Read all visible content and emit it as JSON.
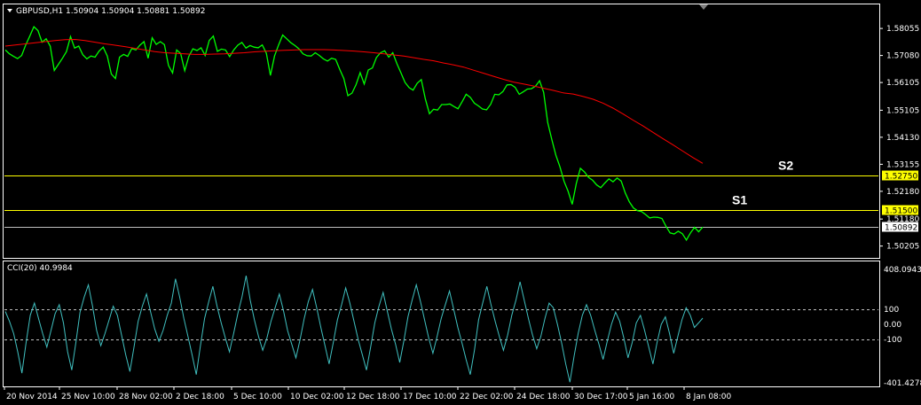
{
  "chart_data": {
    "type": "line",
    "title": "GBPUSD,H1  1.50904 1.50904 1.50881 1.50892",
    "price_panel": {
      "ylim": [
        1.4981,
        1.5889
      ],
      "yticks": [
        "1.58055",
        "1.57080",
        "1.56105",
        "1.55105",
        "1.54130",
        "1.53155",
        "1.52180",
        "1.51180",
        "1.50205"
      ],
      "ytick_values": [
        1.58055,
        1.5708,
        1.56105,
        1.55105,
        1.5413,
        1.53155,
        1.5218,
        1.5118,
        1.50205
      ],
      "price_series": [
        1.5728,
        1.5714,
        1.5705,
        1.5697,
        1.5708,
        1.5746,
        1.5778,
        1.5812,
        1.5798,
        1.5756,
        1.5768,
        1.5742,
        1.5654,
        1.5676,
        1.5698,
        1.5722,
        1.5776,
        1.5735,
        1.5742,
        1.5711,
        1.5696,
        1.5706,
        1.5702,
        1.5724,
        1.5738,
        1.5706,
        1.5641,
        1.5625,
        1.5702,
        1.5712,
        1.5705,
        1.5733,
        1.5728,
        1.5745,
        1.5758,
        1.5698,
        1.5772,
        1.5748,
        1.5758,
        1.5747,
        1.5672,
        1.5645,
        1.5728,
        1.5715,
        1.5653,
        1.5705,
        1.5732,
        1.5726,
        1.5736,
        1.5708,
        1.5762,
        1.5778,
        1.5723,
        1.5731,
        1.5728,
        1.5704,
        1.5728,
        1.5745,
        1.5755,
        1.5735,
        1.5744,
        1.5738,
        1.5736,
        1.5746,
        1.5716,
        1.5636,
        1.5706,
        1.5746,
        1.5782,
        1.5768,
        1.5754,
        1.5744,
        1.5732,
        1.5714,
        1.5707,
        1.5706,
        1.5718,
        1.5708,
        1.5696,
        1.5688,
        1.5698,
        1.5694,
        1.5658,
        1.5625,
        1.5563,
        1.5572,
        1.5603,
        1.5646,
        1.5605,
        1.5656,
        1.5663,
        1.5701,
        1.5718,
        1.5725,
        1.5702,
        1.5718,
        1.5679,
        1.5645,
        1.5611,
        1.5592,
        1.5583,
        1.5608,
        1.5621,
        1.5551,
        1.5498,
        1.5514,
        1.5511,
        1.5531,
        1.5531,
        1.5533,
        1.5524,
        1.5516,
        1.5541,
        1.5568,
        1.5557,
        1.5536,
        1.5526,
        1.5515,
        1.5512,
        1.5532,
        1.5568,
        1.5566,
        1.5578,
        1.5602,
        1.5603,
        1.5593,
        1.5568,
        1.5577,
        1.5587,
        1.5588,
        1.5597,
        1.5617,
        1.5575,
        1.5466,
        1.5405,
        1.5348,
        1.5306,
        1.5254,
        1.5218,
        1.5171,
        1.5246,
        1.5301,
        1.5288,
        1.5268,
        1.5258,
        1.5241,
        1.5231,
        1.5248,
        1.5263,
        1.5252,
        1.5266,
        1.5255,
        1.5212,
        1.518,
        1.5158,
        1.5148,
        1.5145,
        1.5134,
        1.5122,
        1.5125,
        1.5124,
        1.512,
        1.5092,
        1.5068,
        1.5064,
        1.5074,
        1.5065,
        1.5042,
        1.5068,
        1.5088,
        1.5072,
        1.5089
      ],
      "ma_series": [
        1.5742,
        1.5746,
        1.575,
        1.5754,
        1.5758,
        1.5762,
        1.5765,
        1.5766,
        1.5762,
        1.5756,
        1.575,
        1.5745,
        1.574,
        1.5734,
        1.5728,
        1.5722,
        1.5718,
        1.5716,
        1.5714,
        1.5712,
        1.5712,
        1.5713,
        1.5714,
        1.5716,
        1.5718,
        1.5721,
        1.5723,
        1.5725,
        1.5727,
        1.5728,
        1.5729,
        1.5729,
        1.5729,
        1.5728,
        1.5726,
        1.5724,
        1.5721,
        1.5718,
        1.5714,
        1.571,
        1.5706,
        1.57,
        1.5694,
        1.5689,
        1.5681,
        1.5674,
        1.5666,
        1.5655,
        1.5644,
        1.5633,
        1.5622,
        1.5612,
        1.5605,
        1.5598,
        1.559,
        1.5582,
        1.5573,
        1.5569,
        1.556,
        1.555,
        1.5536,
        1.5518,
        1.5497,
        1.5475,
        1.5454,
        1.5431,
        1.5408,
        1.5386,
        1.5363,
        1.534,
        1.5319
      ],
      "ma_start_index": 0,
      "ma_end_index": 110,
      "levels": [
        {
          "name": "S2",
          "value": 1.5275,
          "tag": "1.52750",
          "color": "#ffff00"
        },
        {
          "name": "S1",
          "value": 1.515,
          "tag": "1.51500",
          "color": "#ffff00"
        }
      ],
      "bid_line": {
        "value": 1.50892,
        "tag": "1.50892",
        "color": "#c0c0c0"
      },
      "price_color": "#00ff00",
      "ma_color": "#ff0000"
    },
    "cci_panel": {
      "title": "CCI(20) 40.9984",
      "ylim": [
        -401.4278,
        408.0943
      ],
      "yticks": [
        "408.0943",
        "100",
        "0.00",
        "-100",
        "-401.4278"
      ],
      "ytick_values": [
        408.0943,
        100,
        0,
        -100,
        -401.4278
      ],
      "levels": [
        100,
        -100
      ],
      "series": [
        85,
        20,
        -60,
        -180,
        -320,
        -120,
        60,
        140,
        40,
        -60,
        -150,
        -40,
        70,
        130,
        10,
        -180,
        -300,
        -120,
        80,
        180,
        260,
        120,
        -40,
        -140,
        -60,
        30,
        120,
        60,
        -70,
        -200,
        -310,
        -150,
        20,
        120,
        200,
        80,
        -30,
        -110,
        -40,
        60,
        140,
        300,
        180,
        40,
        -80,
        -200,
        -330,
        -140,
        40,
        150,
        250,
        120,
        10,
        -90,
        -180,
        -60,
        70,
        180,
        320,
        160,
        30,
        -80,
        -170,
        -90,
        20,
        110,
        200,
        90,
        -40,
        -130,
        -220,
        -100,
        40,
        150,
        230,
        110,
        -20,
        -140,
        -260,
        -120,
        30,
        130,
        240,
        140,
        20,
        -100,
        -200,
        -300,
        -150,
        10,
        120,
        210,
        90,
        -30,
        -130,
        -250,
        -110,
        50,
        160,
        260,
        150,
        30,
        -90,
        -190,
        -80,
        40,
        130,
        220,
        100,
        -20,
        -120,
        -230,
        -330,
        -170,
        30,
        140,
        250,
        130,
        20,
        -80,
        -170,
        -70,
        60,
        160,
        280,
        160,
        40,
        -70,
        -160,
        -80,
        40,
        140,
        110,
        0,
        -120,
        -260,
        -380,
        -210,
        -60,
        60,
        130,
        60,
        -40,
        -130,
        -230,
        -110,
        0,
        80,
        20,
        -90,
        -220,
        -120,
        10,
        60,
        -40,
        -150,
        -260,
        -120,
        0,
        50,
        -60,
        -190,
        -80,
        30,
        110,
        60,
        -20,
        10,
        41
      ],
      "color": "#40c0c0"
    },
    "x_tick_labels": [
      "20 Nov 2014",
      "25 Nov 10:00",
      "28 Nov 02:00",
      "2 Dec 18:00",
      "5 Dec 10:00",
      "10 Dec 02:00",
      "12 Dec 18:00",
      "17 Dec 10:00",
      "22 Dec 02:00",
      "24 Dec 18:00",
      "30 Dec 17:00",
      "5 Jan 16:00",
      "8 Jan 08:00"
    ],
    "grid": false
  }
}
